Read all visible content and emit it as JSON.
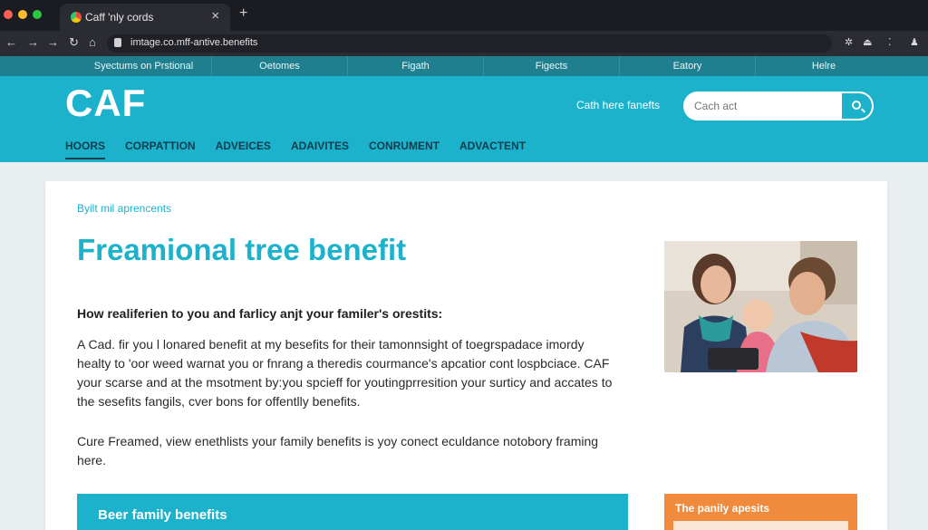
{
  "colors": {
    "brand_teal": "#1cb2cc",
    "utility_teal": "#1f7f8e",
    "nav_text": "#0f3d4d",
    "accent_orange": "#f08a3c",
    "chrome_dark": "#1b1c22"
  },
  "browser": {
    "tab_title": "Caff 'nly cords",
    "tab_close_icon": "×",
    "new_tab_icon": "+",
    "back_icon": "←",
    "forward_icon": "→",
    "go_icon": "→",
    "reload_icon": "↻",
    "home_icon": "⌂",
    "url": "imtage.co.mff-antive.benefits",
    "ext_icons": [
      "✲",
      "⏏",
      "⁚",
      "♟"
    ]
  },
  "utility_nav": [
    "Syectums on Prstional",
    "Oetomes",
    "Figath",
    "Figects",
    "Eatory",
    "Helre"
  ],
  "header": {
    "logo": "CAF",
    "search_label": "Cath here fanefts",
    "search_placeholder": "Cach act"
  },
  "main_nav": [
    "HOORS",
    "CORPATTION",
    "ADVEICES",
    "ADAIVITES",
    "CONRUMENT",
    "ADVACTENT"
  ],
  "content": {
    "breadcrumb": "Byilt mil aprencents",
    "title": "Freamional tree benefit",
    "subhead": "How realiferien to you and farlicy anjt your familer's orestits:",
    "paragraph1": "A Cad. fir you l lonared benefit at my besefits for their tamonnsight of toegrspadace imordy healty to 'oor weed warnat you or fnrang a theredis courmance's apcatior cont lospbciace. CAF your scarse and at the msotment by:you spcieff for youtingprresition your surticy and accates to the sesefits fangils, cver bons for offentlly benefits.",
    "paragraph2": "Cure Freamed, view enethlists your family benefits is yoy conect eculdance notobory framing here.",
    "banner": "Beer family benefits",
    "sidebox": "The panily apesits"
  }
}
